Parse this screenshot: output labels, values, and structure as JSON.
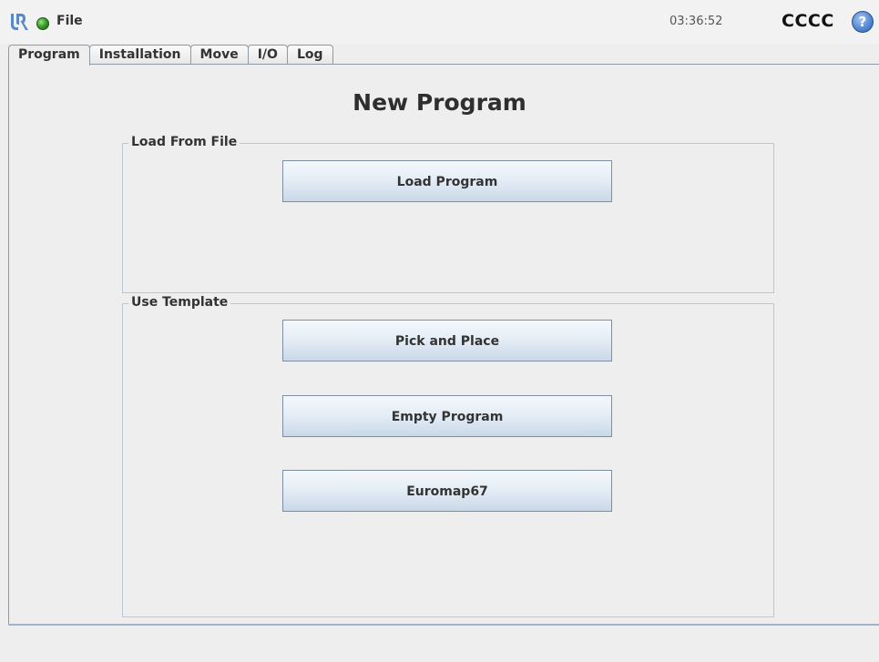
{
  "header": {
    "file_menu": "File",
    "clock": "03:36:52",
    "robot_name": "CCCC",
    "help_glyph": "?",
    "status_color": "#3aa22a",
    "icons": [
      "ur-logo-icon",
      "status-indicator-icon",
      "help-icon"
    ]
  },
  "tabs": [
    {
      "label": "Program",
      "active": true
    },
    {
      "label": "Installation",
      "active": false
    },
    {
      "label": "Move",
      "active": false
    },
    {
      "label": "I/O",
      "active": false
    },
    {
      "label": "Log",
      "active": false
    }
  ],
  "page": {
    "title": "New Program"
  },
  "load_group": {
    "legend": "Load From File",
    "button": "Load Program"
  },
  "template_group": {
    "legend": "Use Template",
    "buttons": [
      "Pick and Place",
      "Empty Program",
      "Euromap67"
    ]
  }
}
